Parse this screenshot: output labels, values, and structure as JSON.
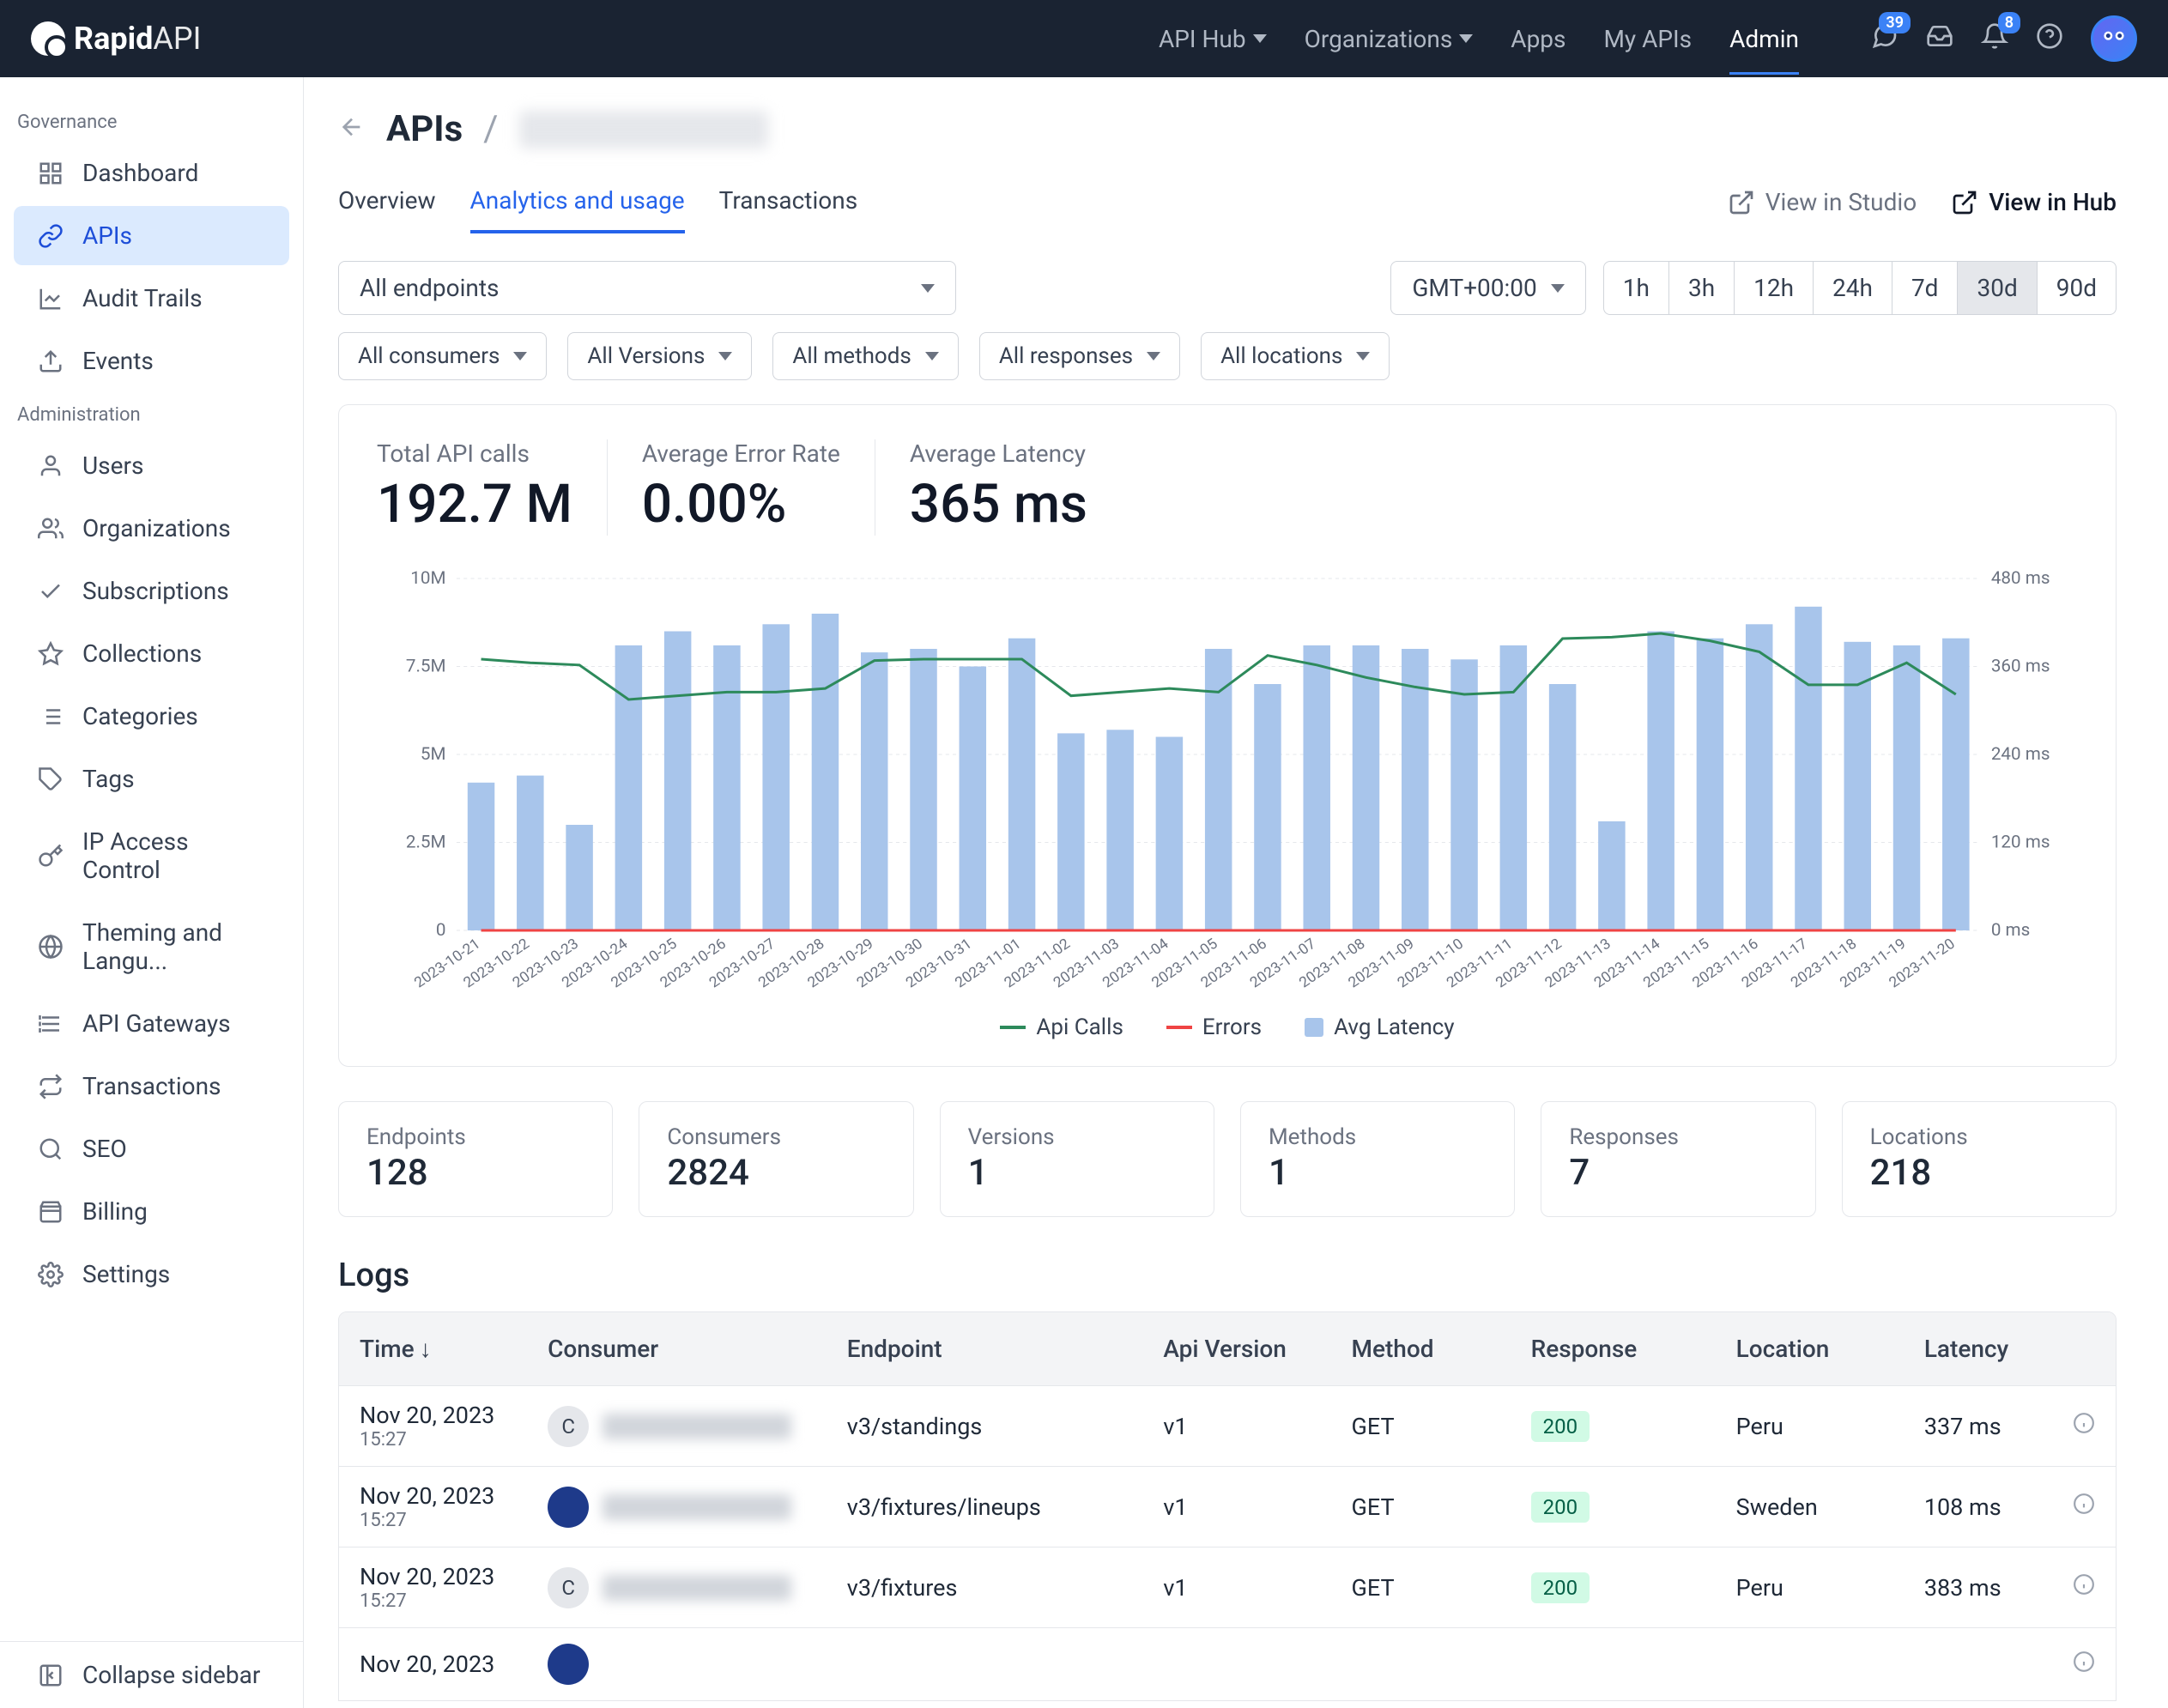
{
  "header": {
    "logo_bold": "Rapid",
    "logo_light": "API",
    "nav": [
      "API Hub",
      "Organizations",
      "Apps",
      "My APIs",
      "Admin"
    ],
    "active_nav": 4,
    "badge1": "39",
    "badge2": "8"
  },
  "sidebar": {
    "section1_title": "Governance",
    "section1_items": [
      "Dashboard",
      "APIs",
      "Audit Trails",
      "Events"
    ],
    "section2_title": "Administration",
    "section2_items": [
      "Users",
      "Organizations",
      "Subscriptions",
      "Collections",
      "Categories",
      "Tags",
      "IP Access Control",
      "Theming and Langu...",
      "API Gateways",
      "Transactions",
      "SEO",
      "Billing",
      "Settings"
    ],
    "active": "APIs",
    "collapse": "Collapse sidebar"
  },
  "breadcrumb": {
    "apis": "APIs",
    "sep": "/"
  },
  "tabs": [
    "Overview",
    "Analytics and usage",
    "Transactions"
  ],
  "active_tab": 1,
  "view_links": {
    "studio": "View in Studio",
    "hub": "View in Hub"
  },
  "filters": {
    "endpoints": "All endpoints",
    "timezone": "GMT+00:00",
    "ranges": [
      "1h",
      "3h",
      "12h",
      "24h",
      "7d",
      "30d",
      "90d"
    ],
    "active_range": 5,
    "row2": [
      "All consumers",
      "All Versions",
      "All methods",
      "All responses",
      "All locations"
    ]
  },
  "metrics": [
    {
      "label": "Total API calls",
      "value": "192.7 M"
    },
    {
      "label": "Average Error Rate",
      "value": "0.00%"
    },
    {
      "label": "Average Latency",
      "value": "365 ms"
    }
  ],
  "chart_data": {
    "type": "bar",
    "categories": [
      "2023-10-21",
      "2023-10-22",
      "2023-10-23",
      "2023-10-24",
      "2023-10-25",
      "2023-10-26",
      "2023-10-27",
      "2023-10-28",
      "2023-10-29",
      "2023-10-30",
      "2023-10-31",
      "2023-11-01",
      "2023-11-02",
      "2023-11-03",
      "2023-11-04",
      "2023-11-05",
      "2023-11-06",
      "2023-11-07",
      "2023-11-08",
      "2023-11-09",
      "2023-11-10",
      "2023-11-11",
      "2023-11-12",
      "2023-11-13",
      "2023-11-14",
      "2023-11-15",
      "2023-11-16",
      "2023-11-17",
      "2023-11-18",
      "2023-11-19",
      "2023-11-20"
    ],
    "series": [
      {
        "name": "Api Calls",
        "type": "bar",
        "color": "#a8c5eb",
        "axis": "left",
        "values": [
          4.2,
          4.4,
          3.0,
          8.1,
          8.5,
          8.1,
          8.7,
          9.0,
          7.9,
          8.0,
          7.5,
          8.3,
          5.6,
          5.7,
          5.5,
          8.0,
          7.0,
          8.1,
          8.1,
          8.0,
          7.7,
          8.1,
          7.0,
          3.1,
          8.5,
          8.3,
          8.7,
          9.2,
          8.2,
          8.1,
          8.3
        ]
      },
      {
        "name": "Errors",
        "type": "line",
        "color": "#ef4444",
        "axis": "left",
        "values": [
          0,
          0,
          0,
          0,
          0,
          0,
          0,
          0,
          0,
          0,
          0,
          0,
          0,
          0,
          0,
          0,
          0,
          0,
          0,
          0,
          0,
          0,
          0,
          0,
          0,
          0,
          0,
          0,
          0,
          0,
          0
        ]
      },
      {
        "name": "Avg Latency",
        "type": "line",
        "color": "#2d8a5b",
        "axis": "right",
        "values": [
          370,
          365,
          362,
          315,
          320,
          325,
          325,
          330,
          368,
          370,
          370,
          370,
          320,
          325,
          330,
          325,
          375,
          362,
          345,
          332,
          322,
          325,
          398,
          400,
          405,
          395,
          380,
          335,
          335,
          365,
          322
        ]
      }
    ],
    "y_left_ticks": [
      "0",
      "2.5M",
      "5M",
      "7.5M",
      "10M"
    ],
    "y_left_max": 10,
    "y_right_ticks": [
      "0 ms",
      "120 ms",
      "240 ms",
      "360 ms",
      "480 ms"
    ],
    "y_right_max": 480,
    "legend": [
      "Api Calls",
      "Errors",
      "Avg Latency"
    ]
  },
  "cards": [
    {
      "label": "Endpoints",
      "value": "128"
    },
    {
      "label": "Consumers",
      "value": "2824"
    },
    {
      "label": "Versions",
      "value": "1"
    },
    {
      "label": "Methods",
      "value": "1"
    },
    {
      "label": "Responses",
      "value": "7"
    },
    {
      "label": "Locations",
      "value": "218"
    }
  ],
  "logs": {
    "title": "Logs",
    "columns": [
      "Time",
      "Consumer",
      "Endpoint",
      "Api Version",
      "Method",
      "Response",
      "Location",
      "Latency"
    ],
    "rows": [
      {
        "date": "Nov 20, 2023",
        "time": "15:27",
        "avatar": "C",
        "avatar_dark": false,
        "consumer_blur": true,
        "consumer": "",
        "endpoint": "v3/standings",
        "version": "v1",
        "method": "GET",
        "response": "200",
        "location": "Peru",
        "latency": "337 ms"
      },
      {
        "date": "Nov 20, 2023",
        "time": "15:27",
        "avatar": "",
        "avatar_dark": true,
        "consumer_blur": true,
        "consumer": "",
        "endpoint": "v3/fixtures/lineups",
        "version": "v1",
        "method": "GET",
        "response": "200",
        "location": "Sweden",
        "latency": "108 ms"
      },
      {
        "date": "Nov 20, 2023",
        "time": "15:27",
        "avatar": "C",
        "avatar_dark": false,
        "consumer_blur": true,
        "consumer": "",
        "endpoint": "v3/fixtures",
        "version": "v1",
        "method": "GET",
        "response": "200",
        "location": "Peru",
        "latency": "383 ms"
      },
      {
        "date": "Nov 20, 2023",
        "time": "",
        "avatar": "",
        "avatar_dark": true,
        "consumer_blur": false,
        "consumer": "",
        "endpoint": "",
        "version": "",
        "method": "",
        "response": "",
        "location": "",
        "latency": ""
      }
    ]
  }
}
